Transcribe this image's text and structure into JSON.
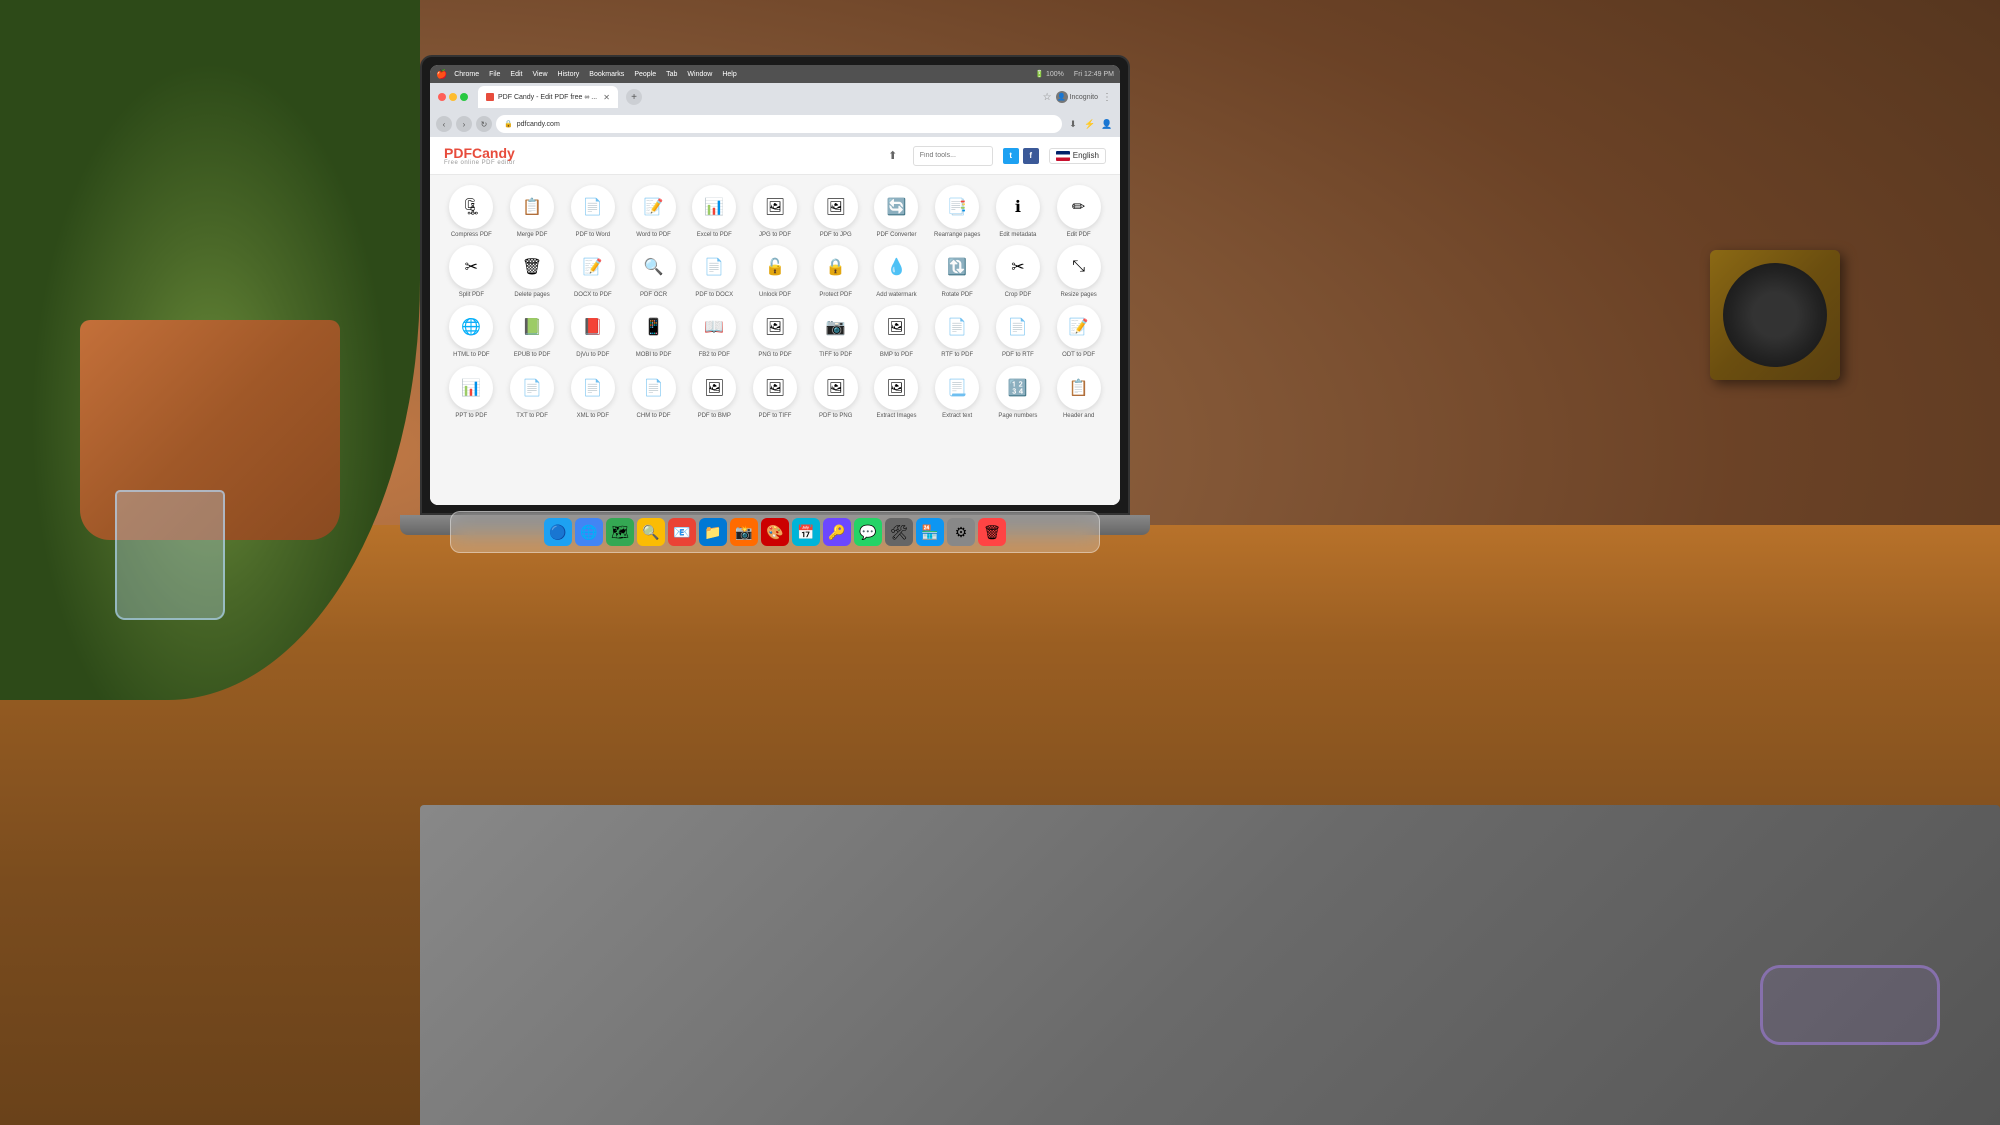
{
  "background": {
    "description": "MacBook Pro on wooden desk with plant and person typing"
  },
  "macos": {
    "menubar": {
      "apple": "🍎",
      "items": [
        "Chrome",
        "File",
        "Edit",
        "View",
        "History",
        "Bookmarks",
        "People",
        "Tab",
        "Window",
        "Help"
      ],
      "time": "Fri 12:49 PM",
      "battery": "100%"
    }
  },
  "chrome": {
    "tab_title": "PDF Candy - Edit PDF free ∞ ...",
    "url": "pdfcandy.com",
    "incognito_label": "Incognito",
    "nav": {
      "back": "‹",
      "forward": "›",
      "refresh": "↻"
    }
  },
  "pdfcandy": {
    "logo_main": "PDFCandy",
    "logo_highlight": "PDF",
    "logo_sub": "Free online PDF editor",
    "search_placeholder": "Find tools...",
    "language": "English",
    "social": {
      "twitter": "t",
      "facebook": "f"
    },
    "tools": [
      {
        "label": "Compress PDF",
        "icon": "🗜",
        "color": "#e74c3c"
      },
      {
        "label": "Merge PDF",
        "icon": "📋",
        "color": "#f39c12"
      },
      {
        "label": "PDF to Word",
        "icon": "📄",
        "color": "#2980b9"
      },
      {
        "label": "Word to PDF",
        "icon": "📝",
        "color": "#2980b9"
      },
      {
        "label": "Excel to PDF",
        "icon": "📊",
        "color": "#27ae60"
      },
      {
        "label": "JPG to PDF",
        "icon": "🖼",
        "color": "#e74c3c"
      },
      {
        "label": "PDF to JPG",
        "icon": "🖼",
        "color": "#e74c3c"
      },
      {
        "label": "PDF Converter",
        "icon": "🔄",
        "color": "#9b59b6"
      },
      {
        "label": "Rearrange pages",
        "icon": "📑",
        "color": "#f39c12"
      },
      {
        "label": "Edit metadata",
        "icon": "ℹ",
        "color": "#7f8c8d"
      },
      {
        "label": "Edit PDF",
        "icon": "✏",
        "color": "#f39c12"
      },
      {
        "label": "Split PDF",
        "icon": "✂",
        "color": "#c0392b"
      },
      {
        "label": "Delete pages",
        "icon": "🗑",
        "color": "#7f8c8d"
      },
      {
        "label": "DOCX to PDF",
        "icon": "📝",
        "color": "#2980b9"
      },
      {
        "label": "PDF OCR",
        "icon": "🔍",
        "color": "#27ae60"
      },
      {
        "label": "PDF to DOCX",
        "icon": "📄",
        "color": "#2980b9"
      },
      {
        "label": "Unlock PDF",
        "icon": "🔓",
        "color": "#7f8c8d"
      },
      {
        "label": "Protect PDF",
        "icon": "🔒",
        "color": "#7f8c8d"
      },
      {
        "label": "Add watermark",
        "icon": "💧",
        "color": "#e74c3c"
      },
      {
        "label": "Rotate PDF",
        "icon": "🔃",
        "color": "#27ae60"
      },
      {
        "label": "Crop PDF",
        "icon": "✂",
        "color": "#7f8c8d"
      },
      {
        "label": "Resize pages",
        "icon": "⤡",
        "color": "#9b59b6"
      },
      {
        "label": "HTML to PDF",
        "icon": "🌐",
        "color": "#e74c3c"
      },
      {
        "label": "EPUB to PDF",
        "icon": "📗",
        "color": "#27ae60"
      },
      {
        "label": "DjVu to PDF",
        "icon": "📕",
        "color": "#c0392b"
      },
      {
        "label": "MOBI to PDF",
        "icon": "📱",
        "color": "#8e44ad"
      },
      {
        "label": "FB2 to PDF",
        "icon": "📖",
        "color": "#7f8c8d"
      },
      {
        "label": "PNG to PDF",
        "icon": "🖼",
        "color": "#3498db"
      },
      {
        "label": "TIFF to PDF",
        "icon": "📷",
        "color": "#7f8c8d"
      },
      {
        "label": "BMP to PDF",
        "icon": "🖼",
        "color": "#e67e22"
      },
      {
        "label": "RTF to PDF",
        "icon": "📄",
        "color": "#9b59b6"
      },
      {
        "label": "PDF to RTF",
        "icon": "📄",
        "color": "#9b59b6"
      },
      {
        "label": "ODT to PDF",
        "icon": "📝",
        "color": "#3498db"
      },
      {
        "label": "PPT to PDF",
        "icon": "📊",
        "color": "#e74c3c"
      },
      {
        "label": "TXT to PDF",
        "icon": "📄",
        "color": "#7f8c8d"
      },
      {
        "label": "XML to PDF",
        "icon": "📄",
        "color": "#7f8c8d"
      },
      {
        "label": "CHM to PDF",
        "icon": "📄",
        "color": "#95a5a6"
      },
      {
        "label": "PDF to BMP",
        "icon": "🖼",
        "color": "#e67e22"
      },
      {
        "label": "PDF to TIFF",
        "icon": "🖼",
        "color": "#7f8c8d"
      },
      {
        "label": "PDF to PNG",
        "icon": "🖼",
        "color": "#3498db"
      },
      {
        "label": "Extract Images",
        "icon": "🖼",
        "color": "#e67e22"
      },
      {
        "label": "Extract text",
        "icon": "📃",
        "color": "#7f8c8d"
      },
      {
        "label": "Page numbers",
        "icon": "🔢",
        "color": "#7f8c8d"
      },
      {
        "label": "Header and",
        "icon": "📋",
        "color": "#7f8c8d"
      }
    ],
    "tool_rows": 4,
    "tool_cols": 11
  },
  "dock": {
    "items": [
      "🔵",
      "🌐",
      "🗺",
      "🔍",
      "📧",
      "📁",
      "📸",
      "🎨",
      "📅",
      "🔑",
      "💬",
      "🛠",
      "🏪",
      "⚙",
      "🗑"
    ]
  }
}
